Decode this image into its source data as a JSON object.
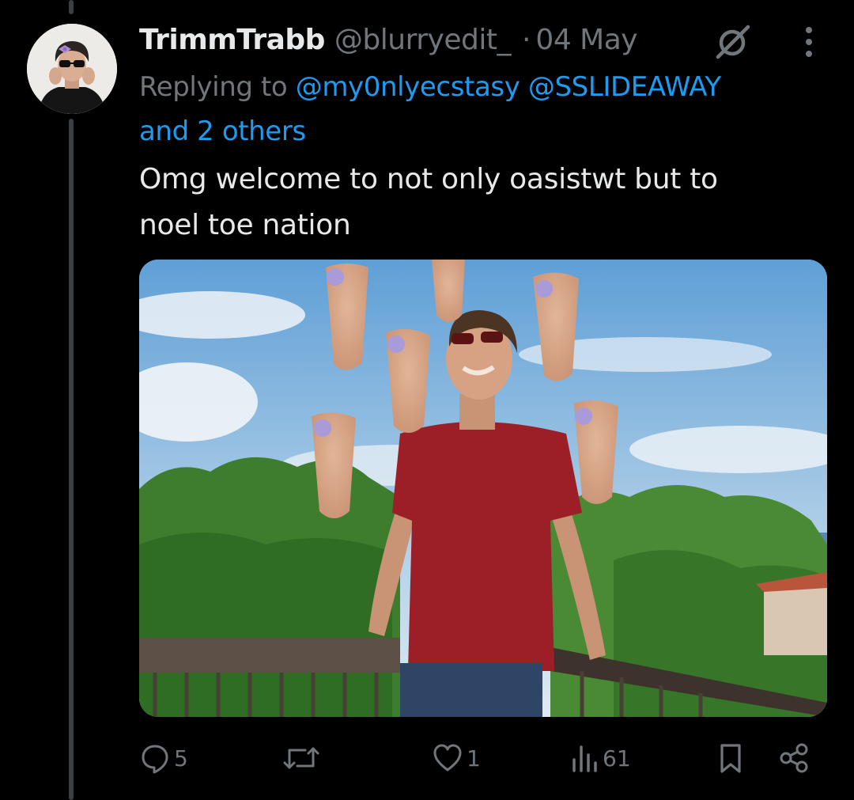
{
  "tweet": {
    "author": {
      "display_name": "TrimmTrabb",
      "handle": "@blurryedit_",
      "separator": "·",
      "date": "04 May",
      "avatar_icon": "avatar-photo"
    },
    "replying": {
      "prefix": "Replying to",
      "mentions": [
        "@my0nlyecstasy",
        "@SSLIDEAWAY"
      ],
      "others": "and 2 others"
    },
    "text_line1": "Omg welcome to not only oasistwt but to",
    "text_line2": "noel toe nation",
    "media": {
      "kind": "photo",
      "icon": "edited-photo"
    },
    "actions": {
      "reply_count": "5",
      "retweet_count": "",
      "like_count": "1",
      "views_count": "61"
    },
    "icons": {
      "reply": "reply-icon",
      "retweet": "retweet-icon",
      "like": "like-icon",
      "views": "views-icon",
      "bookmark": "bookmark-icon",
      "share": "share-icon",
      "grok": "grok-icon",
      "more": "more-icon"
    }
  },
  "colors": {
    "background": "#000000",
    "text": "#e7e9ea",
    "secondary": "#71767b",
    "accent": "#1d9bf0",
    "thread_line": "#3a3f44"
  }
}
